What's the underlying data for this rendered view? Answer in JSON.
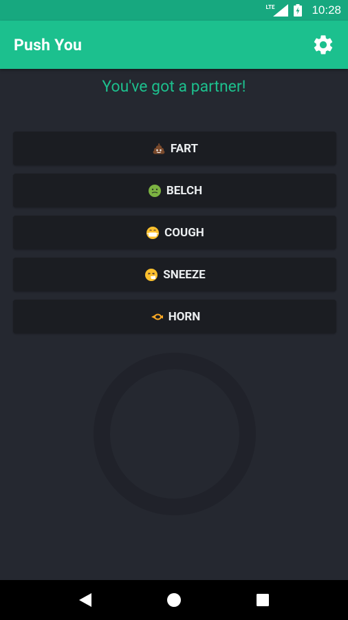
{
  "status_bar": {
    "network_label": "LTE",
    "time": "10:28",
    "icons": [
      "signal-icon",
      "battery-icon"
    ]
  },
  "app_bar": {
    "title": "Push You",
    "settings_icon": "gear-icon"
  },
  "partner_message": "You've got a partner!",
  "sounds": [
    {
      "label": "FART",
      "icon": "poop-emoji"
    },
    {
      "label": "BELCH",
      "icon": "nauseated-face-emoji"
    },
    {
      "label": "COUGH",
      "icon": "face-with-mask-emoji"
    },
    {
      "label": "SNEEZE",
      "icon": "sneezing-face-emoji"
    },
    {
      "label": "HORN",
      "icon": "postal-horn-emoji"
    }
  ],
  "nav_bar": {
    "icons": [
      "back-icon",
      "home-icon",
      "recents-icon"
    ]
  },
  "colors": {
    "status_bar": "#17a87f",
    "app_bar": "#1cc08e",
    "accent_text": "#1dbf8d",
    "background": "#252830",
    "button_bg": "#1b1d22"
  }
}
